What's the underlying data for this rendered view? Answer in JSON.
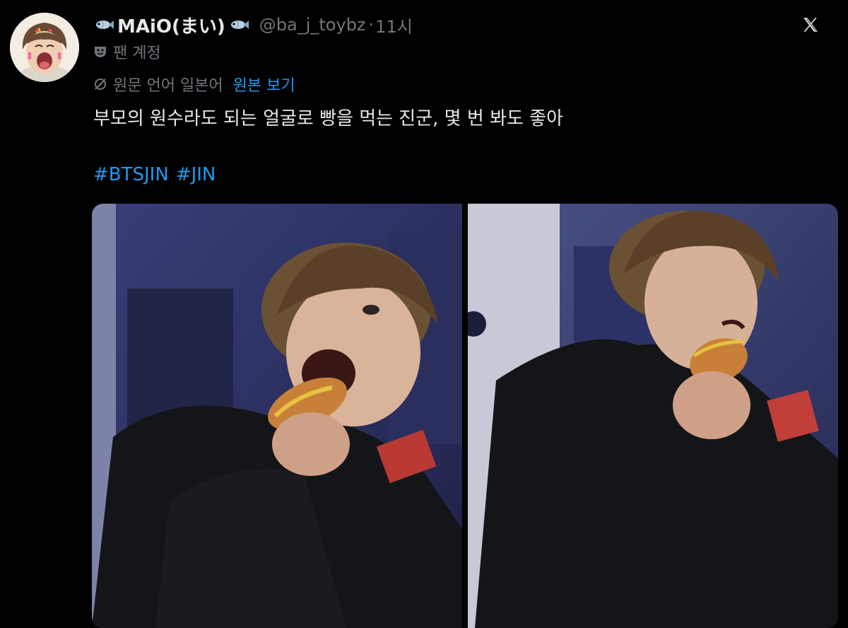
{
  "author": {
    "display_name": "MAiO(まい)",
    "handle": "@ba_j_toybz",
    "separator": "·",
    "time": "11시",
    "avatar_icon": "avatar-photo"
  },
  "account_label": {
    "text": "팬 계정",
    "icon": "theater-mask-icon"
  },
  "translation": {
    "status": "원문 언어 일본어",
    "show_original": "원본 보기",
    "icon": "translate-off-icon"
  },
  "tweet": {
    "text": "부모의 원수라도 되는 얼굴로 빵을 먹는 진군, 몇 번 봐도 좋아",
    "hashtags": [
      "#BTSJIN",
      "#JIN"
    ]
  },
  "media": {
    "count": 2
  },
  "colors": {
    "background": "#000000",
    "text": "#e7e9ea",
    "muted": "#71767b",
    "accent": "#1d9bf0"
  }
}
